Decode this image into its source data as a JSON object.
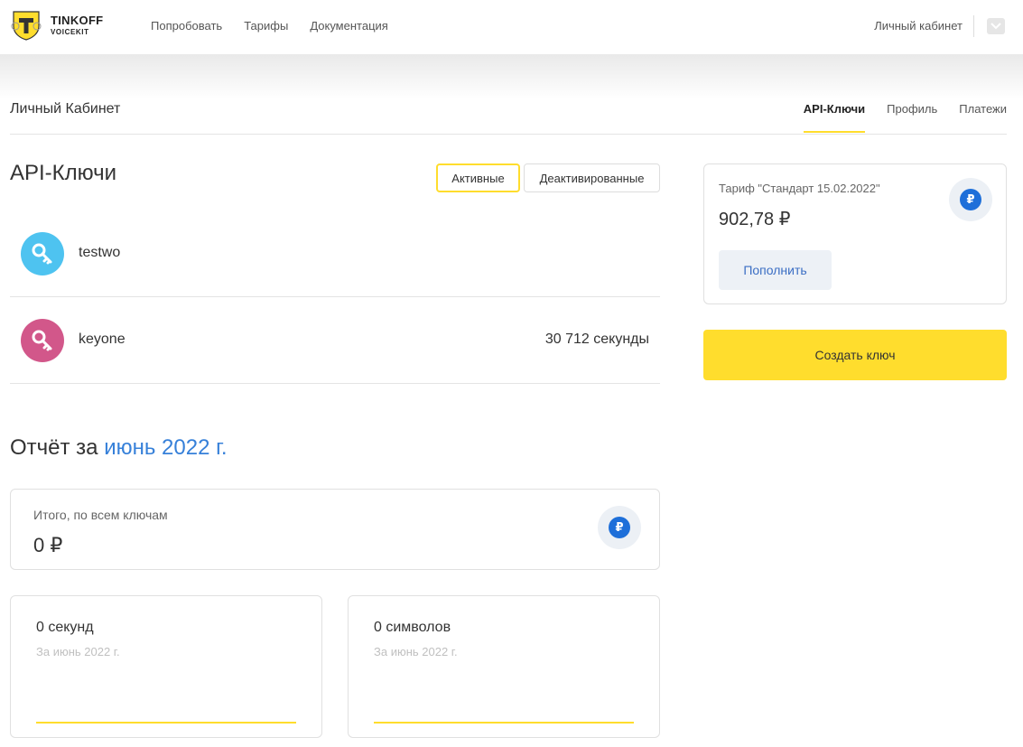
{
  "brand": {
    "title": "TINKOFF",
    "subtitle": "VOICEKIT"
  },
  "topnav": [
    {
      "label": "Попробовать"
    },
    {
      "label": "Тарифы"
    },
    {
      "label": "Документация"
    }
  ],
  "top_account": {
    "label": "Личный кабинет"
  },
  "page": {
    "title": "Личный Кабинет"
  },
  "tabs": [
    {
      "label": "API-Ключи",
      "active": true
    },
    {
      "label": "Профиль",
      "active": false
    },
    {
      "label": "Платежи",
      "active": false
    }
  ],
  "keys_section": {
    "title": "API-Ключи",
    "filters": {
      "active": "Активные",
      "deactivated": "Деактивированные"
    },
    "keys": [
      {
        "name": "testwo",
        "usage": "",
        "color": "#4ec3f0"
      },
      {
        "name": "keyone",
        "usage": "30 712 секунды",
        "color": "#d2578a"
      }
    ]
  },
  "report": {
    "title_prefix": "Отчёт за",
    "month": "июнь 2022 г.",
    "total_label": "Итого, по всем ключам",
    "total_value": "0 ₽",
    "stats": [
      {
        "value": "0 секунд",
        "period": "За июнь 2022 г."
      },
      {
        "value": "0 символов",
        "period": "За июнь 2022 г."
      }
    ]
  },
  "tariff": {
    "label": "Тариф \"Стандарт 15.02.2022\"",
    "balance": "902,78 ₽",
    "topup_label": "Пополнить"
  },
  "create_key_label": "Создать ключ",
  "currency_symbol": "₽",
  "colors": {
    "accent": "#ffdd2d",
    "link": "#3680d9",
    "rub_badge": "#1e6fd9"
  }
}
